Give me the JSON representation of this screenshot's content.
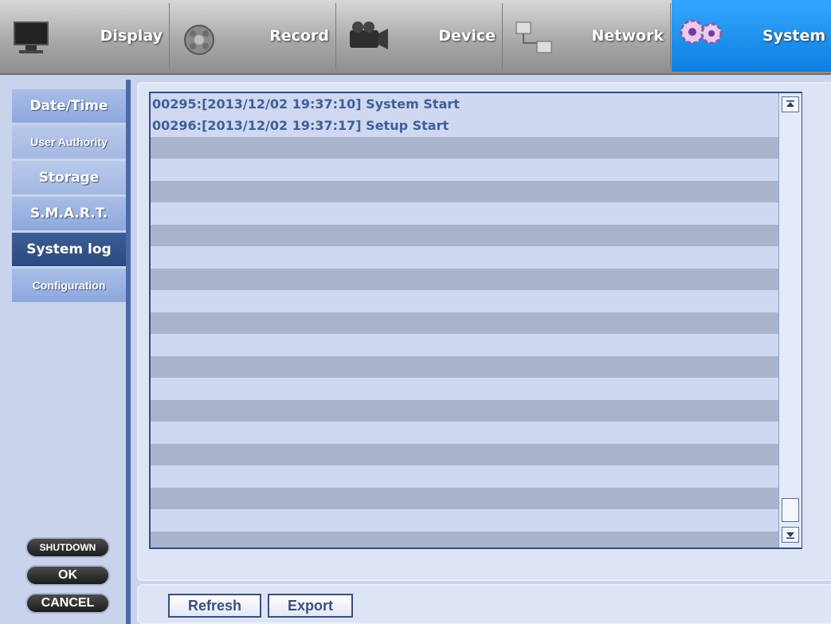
{
  "top_tabs": [
    {
      "label": "Display",
      "icon": "monitor-icon",
      "active": false
    },
    {
      "label": "Record",
      "icon": "film-reel-icon",
      "active": false
    },
    {
      "label": "Device",
      "icon": "camcorder-icon",
      "active": false
    },
    {
      "label": "Network",
      "icon": "network-computers-icon",
      "active": false
    },
    {
      "label": "System",
      "icon": "gears-icon",
      "active": true
    }
  ],
  "sidebar": {
    "items": [
      {
        "label": "Date/Time"
      },
      {
        "label": "User Authority"
      },
      {
        "label": "Storage"
      },
      {
        "label": "S.M.A.R.T."
      },
      {
        "label": "System log",
        "active": true
      },
      {
        "label": "Configuration"
      }
    ]
  },
  "log": {
    "entries": [
      "00295:[2013/12/02 19:37:10] System Start",
      "00296:[2013/12/02 19:37:17] Setup Start"
    ]
  },
  "buttons": {
    "refresh": "Refresh",
    "export": "Export",
    "shutdown": "SHUTDOWN",
    "ok": "OK",
    "cancel": "CANCEL"
  },
  "colors": {
    "active_tab": "#1a8ff0",
    "active_menu": "#33548a",
    "text_blue": "#3e5f97"
  }
}
